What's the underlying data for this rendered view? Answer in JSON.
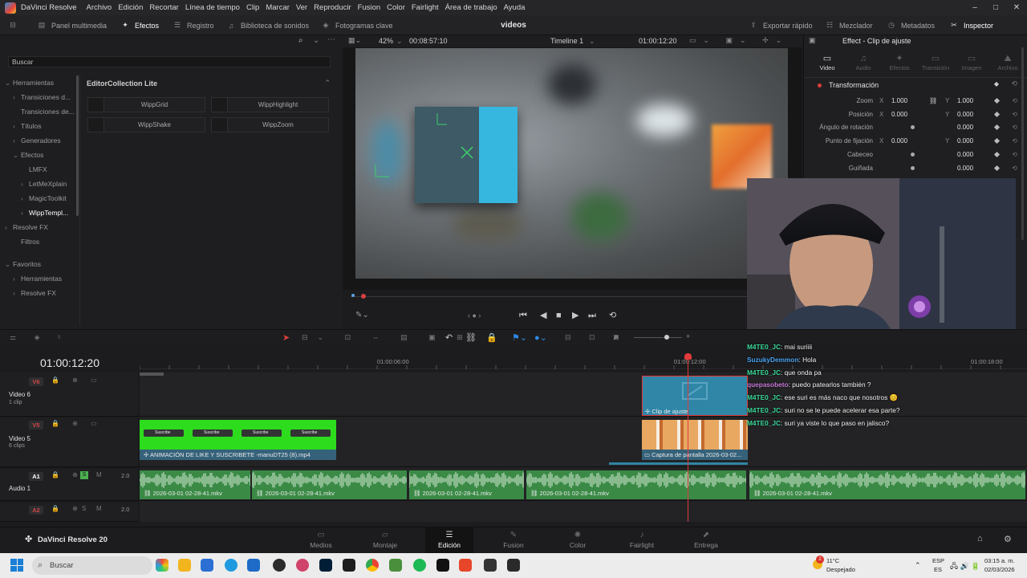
{
  "app": {
    "name": "DaVinci Resolve",
    "menu": [
      "Archivo",
      "Edición",
      "Recortar",
      "Línea de tiempo",
      "Clip",
      "Marcar",
      "Ver",
      "Reproducir",
      "Fusion",
      "Color",
      "Fairlight",
      "Área de trabajo",
      "Ayuda"
    ],
    "window_controls": [
      "–",
      "□",
      "✕"
    ]
  },
  "toolbar": {
    "media_pool": "Panel multimedia",
    "effects": "Efectos",
    "index": "Registro",
    "sound_library": "Biblioteca de sonidos",
    "keyframes": "Fotogramas clave",
    "project_title": "videos",
    "quick_export": "Exportar rápido",
    "mixer": "Mezclador",
    "metadata": "Metadatos",
    "inspector": "Inspector"
  },
  "effects_panel": {
    "search_label": "Buscar",
    "tree": [
      {
        "label": "Herramientas",
        "chev": "⌄",
        "indent": 0
      },
      {
        "label": "Transiciones d...",
        "chev": "›",
        "indent": 1
      },
      {
        "label": "Transiciones de...",
        "chev": "",
        "indent": 1
      },
      {
        "label": "Títulos",
        "chev": "›",
        "indent": 1
      },
      {
        "label": "Generadores",
        "chev": "›",
        "indent": 1
      },
      {
        "label": "Efectos",
        "chev": "⌄",
        "indent": 1
      },
      {
        "label": "LMFX",
        "chev": "",
        "indent": 2
      },
      {
        "label": "LetMeXplain",
        "chev": "›",
        "indent": 2
      },
      {
        "label": "MagicToolkit",
        "chev": "›",
        "indent": 2
      },
      {
        "label": "WippTempl...",
        "chev": "›",
        "indent": 2
      },
      {
        "label": "Resolve FX",
        "chev": "›",
        "indent": 0
      },
      {
        "label": "Filtros",
        "chev": "",
        "indent": 1
      },
      {
        "label": "Favoritos",
        "chev": "⌄",
        "indent": 0
      },
      {
        "label": "Herramientas",
        "chev": "›",
        "indent": 1
      },
      {
        "label": "Resolve FX",
        "chev": "›",
        "indent": 1
      }
    ],
    "collection_title": "EditorCollection Lite",
    "effects": [
      "WippGrid",
      "WippHighlight",
      "WippShake",
      "WippZoom"
    ]
  },
  "viewer": {
    "zoom": "42%",
    "source_timecode": "00:08:57:10",
    "timeline_name": "Timeline 1",
    "record_timecode": "01:00:12:20"
  },
  "inspector": {
    "title": "Effect - Clip de ajuste",
    "tabs": [
      {
        "label": "Video",
        "glyph": "▭"
      },
      {
        "label": "Audio",
        "glyph": "♫"
      },
      {
        "label": "Efectos",
        "glyph": "✦"
      },
      {
        "label": "Transición",
        "glyph": "▭"
      },
      {
        "label": "Imagen",
        "glyph": "▭"
      },
      {
        "label": "Archivo",
        "glyph": "⛰"
      }
    ],
    "section": "Transformación",
    "props": [
      {
        "label": "Zoom",
        "x_axis": "X",
        "x": "1.000",
        "y_axis": "Y",
        "y": "1.000"
      },
      {
        "label": "Posición",
        "x_axis": "X",
        "x": "0.000",
        "y_axis": "Y",
        "y": "0.000"
      },
      {
        "label": "Ángulo de rotación",
        "x_axis": "",
        "x": "",
        "y_axis": "",
        "y": "0.000"
      },
      {
        "label": "Punto de fijación",
        "x_axis": "X",
        "x": "0.000",
        "y_axis": "Y",
        "y": "0.000"
      },
      {
        "label": "Cabeceo",
        "x_axis": "",
        "x": "",
        "y_axis": "",
        "y": "0.000"
      },
      {
        "label": "Guiñada",
        "x_axis": "",
        "x": "",
        "y_axis": "",
        "y": "0.000"
      }
    ]
  },
  "timeline": {
    "timecode": "01:00:12:20",
    "ruler": [
      "01:00:06:00",
      "01:00:12:00",
      "01:00:18:00"
    ],
    "tracks": [
      {
        "id": "V6",
        "name": "Video 6",
        "sub": "1 clip"
      },
      {
        "id": "V5",
        "name": "Video 5",
        "sub": "6 clips"
      },
      {
        "id": "A1",
        "name": "Audio 1",
        "sub": "",
        "level": "2.0"
      },
      {
        "id": "A2",
        "name": "",
        "sub": "",
        "level": "2.0"
      }
    ],
    "clips": {
      "adjustment": "Clip de ajuste",
      "subscribe_anim": "ANIMACIÓN DE LIKE Y SUSCRIBETE -manuDT25 (8).mp4",
      "capture": "Captura de pantalla 2026-03-02...",
      "audio": [
        "2026-03-01 02-28-41.mkv",
        "2026-03-01 02-28-41.mkv",
        "2026-03-01 02-28-41.mkv",
        "2026-03-01 02-28-41.mkv",
        "2026-03-01 02-28-41.mkv"
      ],
      "subscribe_button": "Suscribe"
    }
  },
  "chat": [
    {
      "user": "M4TE0_JC",
      "color": "#3bd99a",
      "msg": ": mai suriiii"
    },
    {
      "user": "SuzukyDemmon",
      "color": "#4aa3f0",
      "msg": ": Hola"
    },
    {
      "user": "M4TE0_JC",
      "color": "#3bd99a",
      "msg": ": que onda pa"
    },
    {
      "user": "quepasobeto",
      "color": "#c77ad8",
      "msg": ": puedo patearlos también ?"
    },
    {
      "user": "M4TE0_JC",
      "color": "#3bd99a",
      "msg": ": ese suri es más naco que nosotros 😊"
    },
    {
      "user": "M4TE0_JC",
      "color": "#3bd99a",
      "msg": ": suri no se le puede acelerar esa parte?"
    },
    {
      "user": "M4TE0_JC",
      "color": "#3bd99a",
      "msg": ": suri ya viste lo que paso en jalisco?"
    }
  ],
  "pages": {
    "brand": "DaVinci Resolve 20",
    "items": [
      {
        "label": "Medios",
        "glyph": "▭"
      },
      {
        "label": "Montaje",
        "glyph": "▱"
      },
      {
        "label": "Edición",
        "glyph": "☰"
      },
      {
        "label": "Fusion",
        "glyph": "✎"
      },
      {
        "label": "Color",
        "glyph": "✺"
      },
      {
        "label": "Fairlight",
        "glyph": "♪"
      },
      {
        "label": "Entrega",
        "glyph": "⬈"
      }
    ]
  },
  "taskbar": {
    "search": "Buscar",
    "weather_temp": "11°C",
    "weather_text": "Despejado",
    "weather_badge": "2",
    "lang": "ESP",
    "region": "ES",
    "time": "03:15 a. m.",
    "date": "02/03/2026"
  },
  "colors": {
    "accent_green": "#2ddc1c",
    "adjust_clip": "#2f86a6",
    "audio_clip": "#3a8a46",
    "playhead": "#e23a3a"
  }
}
